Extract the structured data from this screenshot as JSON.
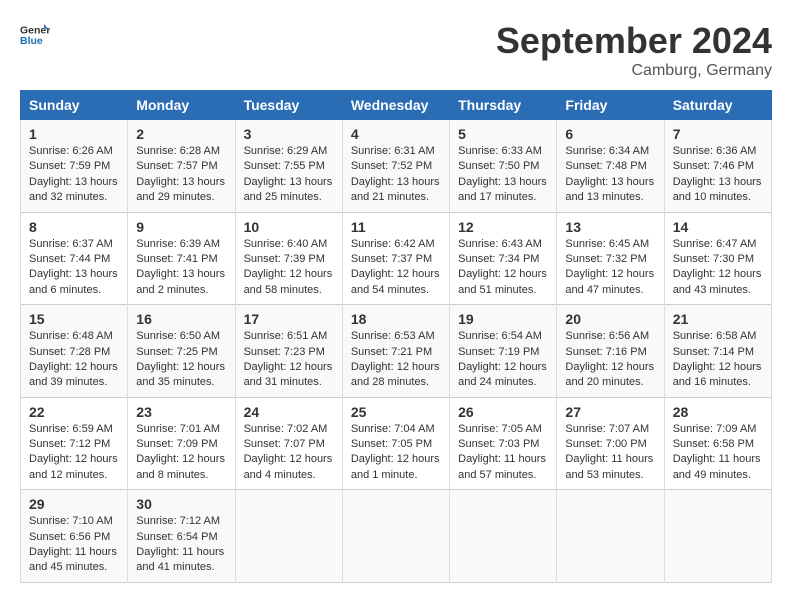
{
  "logo": {
    "general": "General",
    "blue": "Blue"
  },
  "title": "September 2024",
  "location": "Camburg, Germany",
  "days_header": [
    "Sunday",
    "Monday",
    "Tuesday",
    "Wednesday",
    "Thursday",
    "Friday",
    "Saturday"
  ],
  "weeks": [
    [
      {
        "day": "1",
        "info": "Sunrise: 6:26 AM\nSunset: 7:59 PM\nDaylight: 13 hours\nand 32 minutes."
      },
      {
        "day": "2",
        "info": "Sunrise: 6:28 AM\nSunset: 7:57 PM\nDaylight: 13 hours\nand 29 minutes."
      },
      {
        "day": "3",
        "info": "Sunrise: 6:29 AM\nSunset: 7:55 PM\nDaylight: 13 hours\nand 25 minutes."
      },
      {
        "day": "4",
        "info": "Sunrise: 6:31 AM\nSunset: 7:52 PM\nDaylight: 13 hours\nand 21 minutes."
      },
      {
        "day": "5",
        "info": "Sunrise: 6:33 AM\nSunset: 7:50 PM\nDaylight: 13 hours\nand 17 minutes."
      },
      {
        "day": "6",
        "info": "Sunrise: 6:34 AM\nSunset: 7:48 PM\nDaylight: 13 hours\nand 13 minutes."
      },
      {
        "day": "7",
        "info": "Sunrise: 6:36 AM\nSunset: 7:46 PM\nDaylight: 13 hours\nand 10 minutes."
      }
    ],
    [
      {
        "day": "8",
        "info": "Sunrise: 6:37 AM\nSunset: 7:44 PM\nDaylight: 13 hours\nand 6 minutes."
      },
      {
        "day": "9",
        "info": "Sunrise: 6:39 AM\nSunset: 7:41 PM\nDaylight: 13 hours\nand 2 minutes."
      },
      {
        "day": "10",
        "info": "Sunrise: 6:40 AM\nSunset: 7:39 PM\nDaylight: 12 hours\nand 58 minutes."
      },
      {
        "day": "11",
        "info": "Sunrise: 6:42 AM\nSunset: 7:37 PM\nDaylight: 12 hours\nand 54 minutes."
      },
      {
        "day": "12",
        "info": "Sunrise: 6:43 AM\nSunset: 7:34 PM\nDaylight: 12 hours\nand 51 minutes."
      },
      {
        "day": "13",
        "info": "Sunrise: 6:45 AM\nSunset: 7:32 PM\nDaylight: 12 hours\nand 47 minutes."
      },
      {
        "day": "14",
        "info": "Sunrise: 6:47 AM\nSunset: 7:30 PM\nDaylight: 12 hours\nand 43 minutes."
      }
    ],
    [
      {
        "day": "15",
        "info": "Sunrise: 6:48 AM\nSunset: 7:28 PM\nDaylight: 12 hours\nand 39 minutes."
      },
      {
        "day": "16",
        "info": "Sunrise: 6:50 AM\nSunset: 7:25 PM\nDaylight: 12 hours\nand 35 minutes."
      },
      {
        "day": "17",
        "info": "Sunrise: 6:51 AM\nSunset: 7:23 PM\nDaylight: 12 hours\nand 31 minutes."
      },
      {
        "day": "18",
        "info": "Sunrise: 6:53 AM\nSunset: 7:21 PM\nDaylight: 12 hours\nand 28 minutes."
      },
      {
        "day": "19",
        "info": "Sunrise: 6:54 AM\nSunset: 7:19 PM\nDaylight: 12 hours\nand 24 minutes."
      },
      {
        "day": "20",
        "info": "Sunrise: 6:56 AM\nSunset: 7:16 PM\nDaylight: 12 hours\nand 20 minutes."
      },
      {
        "day": "21",
        "info": "Sunrise: 6:58 AM\nSunset: 7:14 PM\nDaylight: 12 hours\nand 16 minutes."
      }
    ],
    [
      {
        "day": "22",
        "info": "Sunrise: 6:59 AM\nSunset: 7:12 PM\nDaylight: 12 hours\nand 12 minutes."
      },
      {
        "day": "23",
        "info": "Sunrise: 7:01 AM\nSunset: 7:09 PM\nDaylight: 12 hours\nand 8 minutes."
      },
      {
        "day": "24",
        "info": "Sunrise: 7:02 AM\nSunset: 7:07 PM\nDaylight: 12 hours\nand 4 minutes."
      },
      {
        "day": "25",
        "info": "Sunrise: 7:04 AM\nSunset: 7:05 PM\nDaylight: 12 hours\nand 1 minute."
      },
      {
        "day": "26",
        "info": "Sunrise: 7:05 AM\nSunset: 7:03 PM\nDaylight: 11 hours\nand 57 minutes."
      },
      {
        "day": "27",
        "info": "Sunrise: 7:07 AM\nSunset: 7:00 PM\nDaylight: 11 hours\nand 53 minutes."
      },
      {
        "day": "28",
        "info": "Sunrise: 7:09 AM\nSunset: 6:58 PM\nDaylight: 11 hours\nand 49 minutes."
      }
    ],
    [
      {
        "day": "29",
        "info": "Sunrise: 7:10 AM\nSunset: 6:56 PM\nDaylight: 11 hours\nand 45 minutes."
      },
      {
        "day": "30",
        "info": "Sunrise: 7:12 AM\nSunset: 6:54 PM\nDaylight: 11 hours\nand 41 minutes."
      },
      {
        "day": "",
        "info": ""
      },
      {
        "day": "",
        "info": ""
      },
      {
        "day": "",
        "info": ""
      },
      {
        "day": "",
        "info": ""
      },
      {
        "day": "",
        "info": ""
      }
    ]
  ]
}
